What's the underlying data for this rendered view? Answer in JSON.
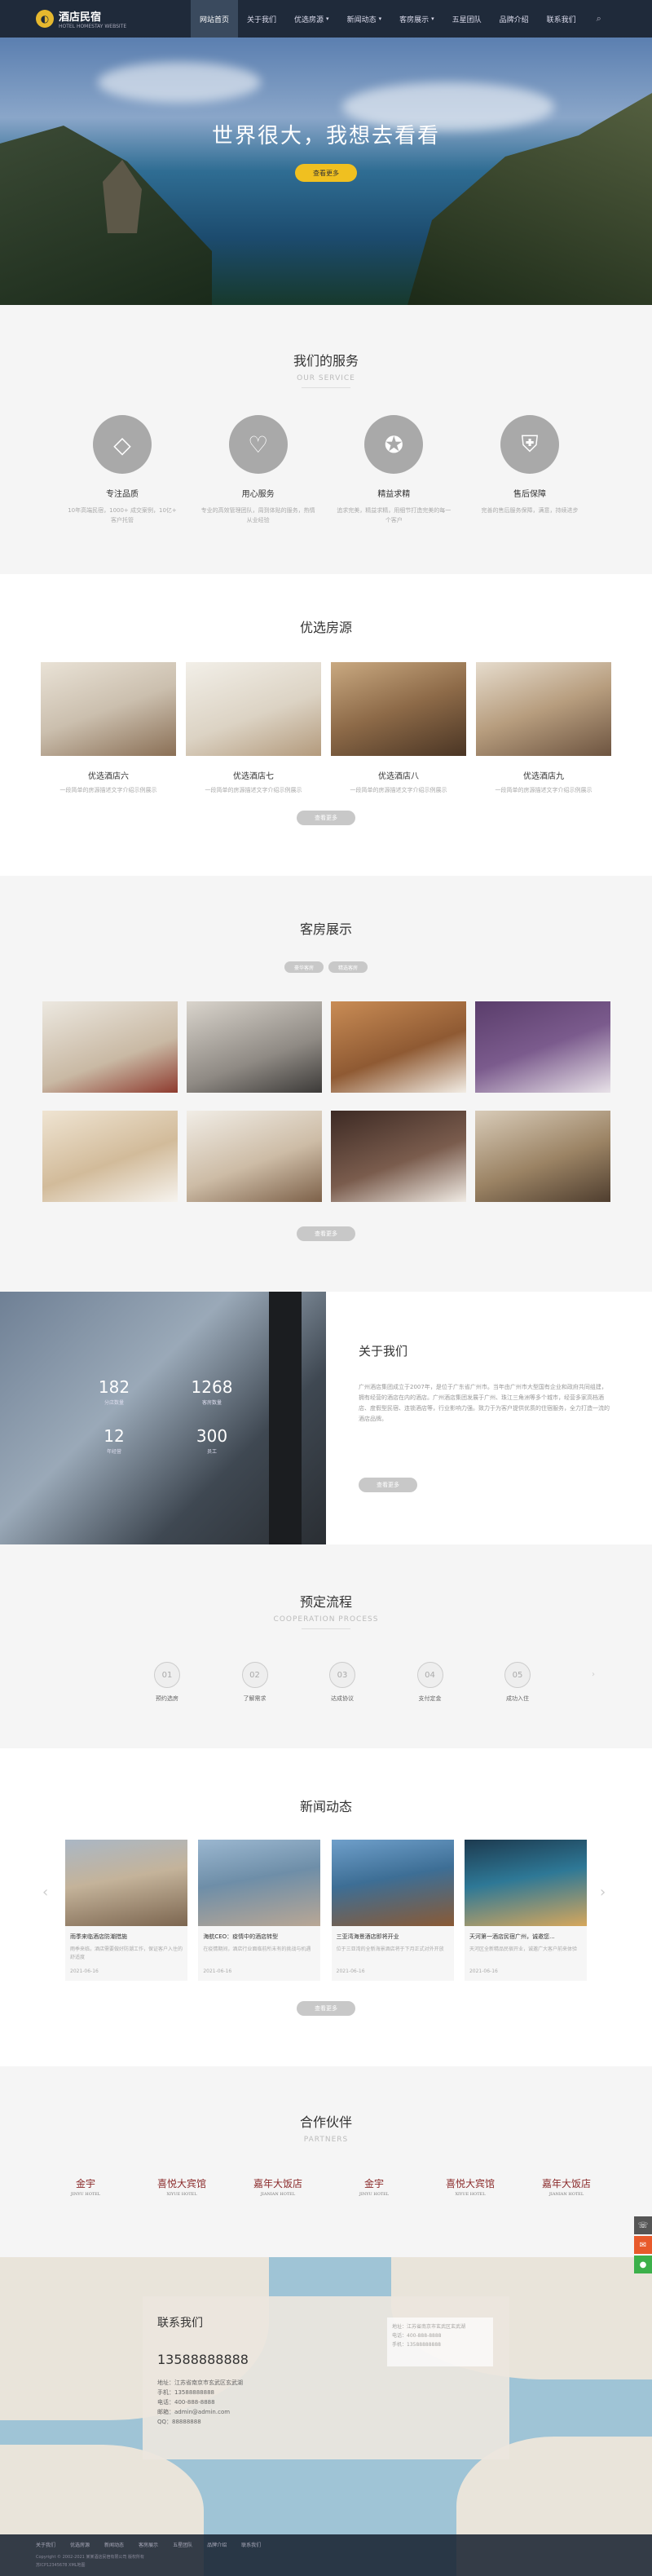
{
  "header": {
    "logo_text": "酒店民宿",
    "logo_sub": "HOTEL HOMESTAY WEBSITE",
    "nav": [
      {
        "label": "网站首页",
        "active": true,
        "dropdown": false
      },
      {
        "label": "关于我们",
        "active": false,
        "dropdown": false
      },
      {
        "label": "优选房源",
        "active": false,
        "dropdown": true
      },
      {
        "label": "新闻动态",
        "active": false,
        "dropdown": true
      },
      {
        "label": "客房展示",
        "active": false,
        "dropdown": true
      },
      {
        "label": "五星团队",
        "active": false,
        "dropdown": false
      },
      {
        "label": "品牌介绍",
        "active": false,
        "dropdown": false
      },
      {
        "label": "联系我们",
        "active": false,
        "dropdown": false
      }
    ]
  },
  "hero": {
    "title": "世界很大，我想去看看",
    "button": "查看更多"
  },
  "services": {
    "title": "我们的服务",
    "subtitle": "OUR SERVICE",
    "items": [
      {
        "name": "专注品质",
        "desc": "10年高端民宿，1000+ 成交案例，10亿+ 客户托管",
        "icon": "diamond-icon"
      },
      {
        "name": "用心服务",
        "desc": "专业的高效管理团队，周到体贴的服务，热情从业经验",
        "icon": "heart-icon"
      },
      {
        "name": "精益求精",
        "desc": "追求完美，精益求精，用细节打造完美的每一个客户",
        "icon": "medal-icon"
      },
      {
        "name": "售后保障",
        "desc": "完善的售后服务保障，满意，持续进步",
        "icon": "shield-icon"
      }
    ]
  },
  "rooms": {
    "title": "优选房源",
    "items": [
      {
        "name": "优选酒店六",
        "desc": "一段简单的房源描述文字介绍示例展示"
      },
      {
        "name": "优选酒店七",
        "desc": "一段简单的房源描述文字介绍示例展示"
      },
      {
        "name": "优选酒店八",
        "desc": "一段简单的房源描述文字介绍示例展示"
      },
      {
        "name": "优选酒店九",
        "desc": "一段简单的房源描述文字介绍示例展示"
      }
    ],
    "more": "查看更多"
  },
  "gallery": {
    "title": "客房展示",
    "tabs": [
      "豪华客房",
      "精选客房"
    ],
    "more": "查看更多"
  },
  "about": {
    "title": "关于我们",
    "body": "广州酒店集团成立于2007年，是位于广东省广州市。当年由广州市大型国有企业和政府共同组建，拥有经营的酒店在内的酒店。广州酒店集团发展于广州、珠江三角洲等多个城市，经营多家高档酒店、度假型民宿、连锁酒店等，行业影响力强。致力于为客户提供优质的住宿服务，全力打造一流的酒店品牌。",
    "button": "查看更多",
    "stats": [
      {
        "num": "182",
        "label": "分店数量"
      },
      {
        "num": "1268",
        "label": "客房数量"
      },
      {
        "num": "12",
        "label": "年经营"
      },
      {
        "num": "300",
        "label": "员工"
      }
    ]
  },
  "process": {
    "title": "预定流程",
    "subtitle": "COOPERATION PROCESS",
    "steps": [
      {
        "num": "01",
        "label": "预约选房"
      },
      {
        "num": "02",
        "label": "了解需求"
      },
      {
        "num": "03",
        "label": "达成协议"
      },
      {
        "num": "04",
        "label": "支付定金"
      },
      {
        "num": "05",
        "label": "成功入住"
      }
    ]
  },
  "news": {
    "title": "新闻动态",
    "items": [
      {
        "title": "雨季来临酒店防潮措施",
        "desc": "雨季来临，酒店需要做好防潮工作，保证客户入住的舒适度",
        "date": "2021-06-16"
      },
      {
        "title": "海航CEO：疫情中的酒店转型",
        "desc": "在疫情期间，酒店行业面临前所未有的挑战与机遇",
        "date": "2021-06-16"
      },
      {
        "title": "三亚湾海景酒店即将开业",
        "desc": "位于三亚湾的全新海景酒店将于下月正式对外开放",
        "date": "2021-06-16"
      },
      {
        "title": "天河第一酒店民宿广州，诚邀您...",
        "desc": "天河区全新精品民宿开业，诚邀广大客户前来体验",
        "date": "2021-06-16"
      }
    ],
    "more": "查看更多"
  },
  "partners": {
    "title": "合作伙伴",
    "subtitle": "PARTNERS",
    "logos": [
      {
        "name": "金宇",
        "sub": "JINYU HOTEL"
      },
      {
        "name": "喜悦大宾馆",
        "sub": "XIYUE HOTEL"
      },
      {
        "name": "嘉年大饭店",
        "sub": "JIANIAN HOTEL"
      },
      {
        "name": "金宇",
        "sub": "JINYU HOTEL"
      },
      {
        "name": "喜悦大宾馆",
        "sub": "XIYUE HOTEL"
      },
      {
        "name": "嘉年大饭店",
        "sub": "JIANIAN HOTEL"
      }
    ]
  },
  "contact": {
    "title": "联系我们",
    "phone": "13588888888",
    "address": "地址：江苏省南京市玄武区玄武湖",
    "mobile": "手机：13588888888",
    "tel": "电话：400-888-8888",
    "email": "邮箱：admin@admin.com",
    "qq": "QQ：88888888",
    "qr_lines": [
      "地址：江苏省南京市玄武区玄武湖",
      "电话：400-888-8888",
      "手机：13588888888"
    ]
  },
  "footer": {
    "links": [
      "关于我们",
      "优选房源",
      "新闻动态",
      "客房展示",
      "五星团队",
      "品牌介绍",
      "联系我们"
    ],
    "copyright": "Copyright © 2002-2021 某某酒店民宿有限公司 版权所有",
    "icp": "苏ICP12345678 XML地图"
  },
  "colors": {
    "header_bg": "#1f2a3a",
    "accent": "#f0c020",
    "section_gray": "#f5f5f5"
  }
}
